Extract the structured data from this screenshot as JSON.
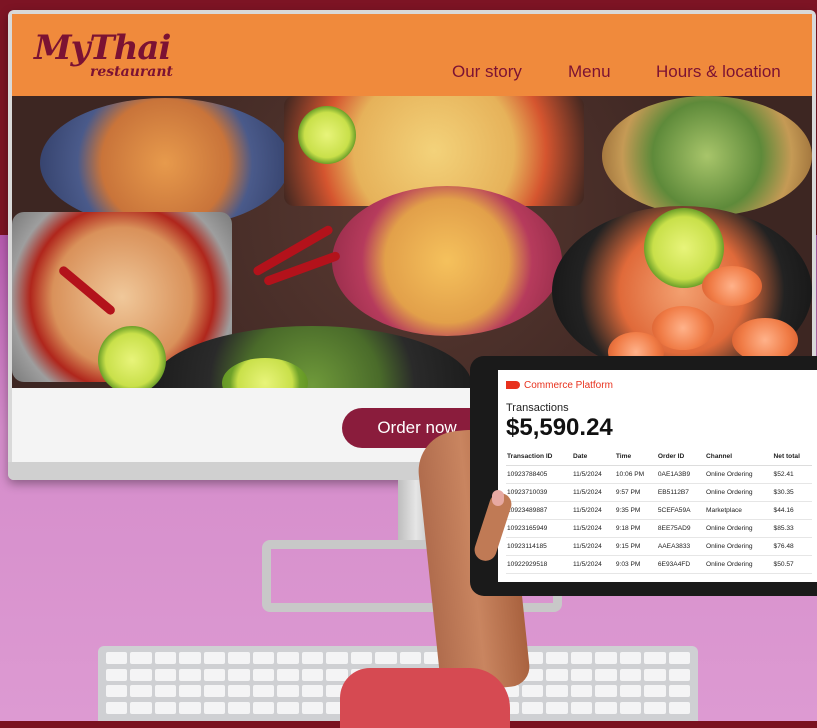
{
  "site": {
    "logo_main": "MyThai",
    "logo_sub": "restaurant",
    "nav": [
      "Our story",
      "Menu",
      "Hours & location"
    ],
    "order_button": "Order now"
  },
  "tablet": {
    "brand": "Commerce Platform",
    "section_title": "Transactions",
    "total": "$5,590.24",
    "columns": [
      "Transaction ID",
      "Date",
      "Time",
      "Order ID",
      "Channel",
      "Net total"
    ],
    "rows": [
      [
        "10923788405",
        "11/5/2024",
        "10:06 PM",
        "0AE1A3B9",
        "Online Ordering",
        "$52.41"
      ],
      [
        "10923710039",
        "11/5/2024",
        "9:57 PM",
        "EB5112B7",
        "Online Ordering",
        "$30.35"
      ],
      [
        "10923489887",
        "11/5/2024",
        "9:35 PM",
        "5CEFA59A",
        "Marketplace",
        "$44.16"
      ],
      [
        "10923165949",
        "11/5/2024",
        "9:18 PM",
        "8EE75AD9",
        "Online Ordering",
        "$85.33"
      ],
      [
        "10923114185",
        "11/5/2024",
        "9:15 PM",
        "AAEA3833",
        "Online Ordering",
        "$76.48"
      ],
      [
        "10922929518",
        "11/5/2024",
        "9:03 PM",
        "6E93A4FD",
        "Online Ordering",
        "$50.57"
      ]
    ]
  },
  "colors": {
    "header_orange": "#f08a3c",
    "brand_maroon": "#7b1233",
    "button": "#8a1c3c",
    "platform_red": "#e8321e"
  }
}
